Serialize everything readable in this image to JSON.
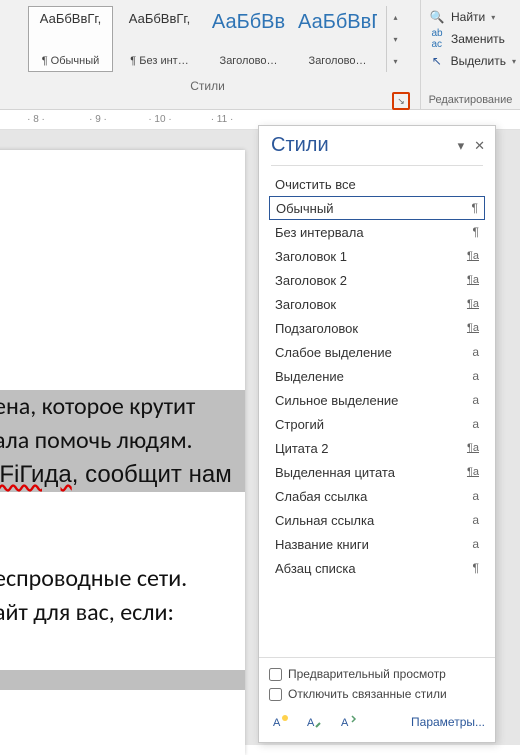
{
  "ribbon": {
    "styles": [
      {
        "preview": "АаБбВвГг,",
        "label": "¶ Обычный",
        "selected": true,
        "big": false
      },
      {
        "preview": "АаБбВвГг,",
        "label": "¶ Без инт…",
        "selected": false,
        "big": false
      },
      {
        "preview": "АаБбВв",
        "label": "Заголово…",
        "selected": false,
        "big": true
      },
      {
        "preview": "АаБбВвГ",
        "label": "Заголово…",
        "selected": false,
        "big": true
      }
    ],
    "group_label": "Стили",
    "editing": {
      "find": "Найти",
      "replace": "Заменить",
      "select": "Выделить",
      "group_label": "Редактирование"
    }
  },
  "ruler": [
    "8",
    "9",
    "10",
    "11"
  ],
  "pane": {
    "title": "Стили",
    "items": [
      {
        "name": "Очистить все",
        "mark": ""
      },
      {
        "name": "Обычный",
        "mark": "¶",
        "selected": true
      },
      {
        "name": "Без интервала",
        "mark": "¶"
      },
      {
        "name": "Заголовок 1",
        "mark": "¶a",
        "link": true
      },
      {
        "name": "Заголовок 2",
        "mark": "¶a",
        "link": true
      },
      {
        "name": "Заголовок",
        "mark": "¶a",
        "link": true
      },
      {
        "name": "Подзаголовок",
        "mark": "¶a",
        "link": true
      },
      {
        "name": "Слабое выделение",
        "mark": "a"
      },
      {
        "name": "Выделение",
        "mark": "a"
      },
      {
        "name": "Сильное выделение",
        "mark": "a"
      },
      {
        "name": "Строгий",
        "mark": "a"
      },
      {
        "name": "Цитата 2",
        "mark": "¶a",
        "link": true
      },
      {
        "name": "Выделенная цитата",
        "mark": "¶a",
        "link": true
      },
      {
        "name": "Слабая ссылка",
        "mark": "a"
      },
      {
        "name": "Сильная ссылка",
        "mark": "a"
      },
      {
        "name": "Название книги",
        "mark": "a"
      },
      {
        "name": "Абзац списка",
        "mark": "¶"
      }
    ],
    "preview_chk": "Предварительный просмотр",
    "disable_linked_chk": "Отключить связанные стили",
    "params": "Параметры..."
  },
  "doc": {
    "l1": "ена, которое крутит",
    "l2": "ала помочь людям.",
    "l3a": "iFiГида",
    "l3b": ", сообщит нам",
    "l4": "еспроводные сети.",
    "l5": "айт для вас, если:"
  }
}
